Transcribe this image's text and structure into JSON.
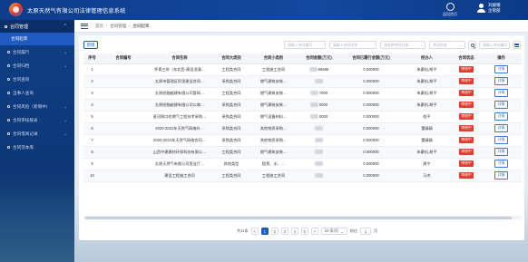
{
  "header": {
    "app_title": "太原天然气有限公司法律管理信息系统",
    "actions": [
      {
        "label": "返回首页",
        "icon": "home-icon"
      },
      {
        "label": "",
        "icon": "user-icon"
      }
    ],
    "user_line1": "刘骏耀",
    "user_line2": "企管部"
  },
  "sidebar": {
    "group_label": "合同管理",
    "active_sub": "合同起草",
    "items": [
      {
        "label": "合同履行",
        "caret": "⌄"
      },
      {
        "label": "合同归档",
        "caret": "⌄"
      },
      {
        "label": "合同查询",
        "caret": ""
      },
      {
        "label": "当事人查询",
        "caret": ""
      },
      {
        "label": "合同风险（新增中）",
        "caret": "⌄"
      },
      {
        "label": "合同审核报表",
        "caret": "⌄"
      },
      {
        "label": "合同借阅记录",
        "caret": "⌄"
      },
      {
        "label": "合同范本库",
        "caret": ""
      }
    ]
  },
  "breadcrumb": {
    "items": [
      "首页",
      "合同管理",
      "合同起草"
    ]
  },
  "toolbar": {
    "add_label": "新增",
    "filters": [
      {
        "placeholder": "请输入合同编号"
      },
      {
        "placeholder": "请输入合同名称"
      },
      {
        "placeholder": "请选择合同分类"
      },
      {
        "placeholder": "合同状态"
      }
    ]
  },
  "table": {
    "columns": [
      "序号",
      "合同编号",
      "合同名称",
      "合同大类别",
      "合同小类别",
      "合同金额(万元)",
      "合同已履行金额(万元)",
      "经办人",
      "合同状态",
      "操作"
    ],
    "rows": [
      {
        "no": "1",
        "code": "",
        "name": "怀青三岸（东北西-建设池涌…",
        "major": "工程类合同",
        "minor": "工程施工合同",
        "amount": "66696",
        "performed": "0.000000",
        "handler": "朱豪松,胡平",
        "status": "审核中",
        "op": "详情"
      },
      {
        "no": "2",
        "code": "",
        "name": "太原市管理区阿里建设合同…",
        "major": "采购类合同",
        "minor": "燃气建筑安装…",
        "amount": "",
        "performed": "0.000000",
        "handler": "朱豪松,胡平",
        "status": "审核中",
        "op": "详情"
      },
      {
        "no": "3",
        "code": "",
        "name": "太原经融越建有限公司管网…",
        "major": "工程类合同",
        "minor": "燃气建筑安装…",
        "amount": "7000",
        "performed": "0.000000",
        "handler": "朱豪松,胡平",
        "status": "审核中",
        "op": "详情"
      },
      {
        "no": "4",
        "code": "",
        "name": "太原经融越建有限公司公墩…",
        "major": "采购类合同",
        "minor": "燃气建筑安装…",
        "amount": "0000",
        "performed": "0.000000",
        "handler": "朱豪松,胡平",
        "status": "审核中",
        "op": "详情"
      },
      {
        "no": "5",
        "code": "",
        "name": "晋河周口也燃气工程技术采购…",
        "major": "采购类合同",
        "minor": "燃气设备材料…",
        "amount": "0000",
        "performed": "0.000000",
        "handler": "档平",
        "status": "审核中",
        "op": "详情"
      },
      {
        "no": "6",
        "code": "",
        "name": "2020-2021年天然气网络外…",
        "major": "采购类合同",
        "minor": "其他物资采购…",
        "amount": "",
        "performed": "0.000000",
        "handler": "董婧婧",
        "status": "审核中",
        "op": "详情"
      },
      {
        "no": "7",
        "code": "",
        "name": "2020-2021年天然气网络合同…",
        "major": "采购类合同",
        "minor": "其他物资采购…",
        "amount": "",
        "performed": "0.000000",
        "handler": "董婧婧",
        "status": "审核中",
        "op": "详情"
      },
      {
        "no": "8",
        "code": "",
        "name": "山西中建建材环保科技有限公…",
        "major": "工程类合同",
        "minor": "燃气建筑安装…",
        "amount": "",
        "performed": "0.000000",
        "handler": "朱豪松,胡平",
        "status": "审核中",
        "op": "详情"
      },
      {
        "no": "9",
        "code": "",
        "name": "太原天然气有限公司营业厅…",
        "major": "其他类型",
        "minor": "租赁、水、…",
        "amount": "",
        "performed": "0.000000",
        "handler": "周宁",
        "status": "审核中",
        "op": "详情"
      },
      {
        "no": "10",
        "code": "",
        "name": "建设工程施工合同",
        "major": "工程类合同",
        "minor": "工程施工合同",
        "amount": "",
        "performed": "0.000000",
        "handler": "马杰",
        "status": "审核中",
        "op": "详情"
      }
    ]
  },
  "pagination": {
    "total_label": "共11条",
    "prev": "<",
    "pages": [
      "1",
      "2",
      "3",
      "4",
      "5"
    ],
    "next": ">",
    "page_size": "10 条/页",
    "goto_label": "前往",
    "goto_value": "1",
    "page_suffix": "页"
  }
}
